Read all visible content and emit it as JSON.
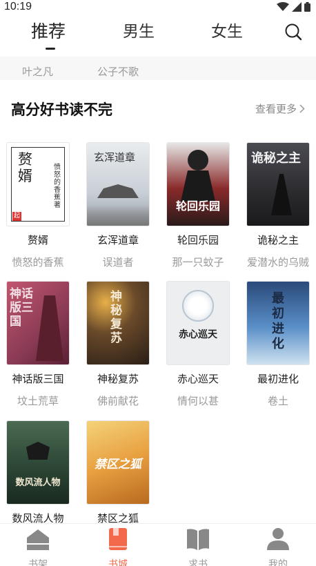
{
  "status": {
    "time": "10:19"
  },
  "tabs": [
    "推荐",
    "男生",
    "女生"
  ],
  "prev_authors": [
    "叶之凡",
    "公子不歌"
  ],
  "section": {
    "title": "高分好书读不完",
    "more": "查看更多"
  },
  "books": [
    {
      "title": "赘婿",
      "author": "愤怒的香蕉",
      "cover_text": "赘婿",
      "cover_bg": "#ffffff"
    },
    {
      "title": "玄浑道章",
      "author": "误道者",
      "cover_text": "玄浑道章",
      "cover_bg": "#c9cfd6"
    },
    {
      "title": "轮回乐园",
      "author": "那一只蚊子",
      "cover_text": "轮回乐园",
      "cover_bg": "#3a2a2a"
    },
    {
      "title": "诡秘之主",
      "author": "爱潜水的乌贼",
      "cover_text": "诡秘之主",
      "cover_bg": "#2b2b2e"
    },
    {
      "title": "神话版三国",
      "author": "坟土荒草",
      "cover_text": "神话版三国",
      "cover_bg": "#8a3a55"
    },
    {
      "title": "神秘复苏",
      "author": "佛前献花",
      "cover_text": "神秘复苏",
      "cover_bg": "#3a2e22"
    },
    {
      "title": "赤心巡天",
      "author": "情何以甚",
      "cover_text": "赤心巡天",
      "cover_bg": "#e8eaec"
    },
    {
      "title": "最初进化",
      "author": "卷土",
      "cover_text": "最初进化",
      "cover_bg": "#5a7fa8"
    },
    {
      "title": "数风流人物",
      "author": "",
      "cover_text": "数风流人物",
      "cover_bg": "#2f4a38"
    },
    {
      "title": "禁区之狐",
      "author": "",
      "cover_text": "禁区之狐",
      "cover_bg": "#e8a040"
    }
  ],
  "nav": [
    {
      "label": "书架",
      "icon": "bookshelf-icon"
    },
    {
      "label": "书城",
      "icon": "bookstore-icon"
    },
    {
      "label": "求书",
      "icon": "request-book-icon"
    },
    {
      "label": "我的",
      "icon": "profile-icon"
    }
  ],
  "colors": {
    "accent": "#f26a4b",
    "muted": "#999999"
  }
}
